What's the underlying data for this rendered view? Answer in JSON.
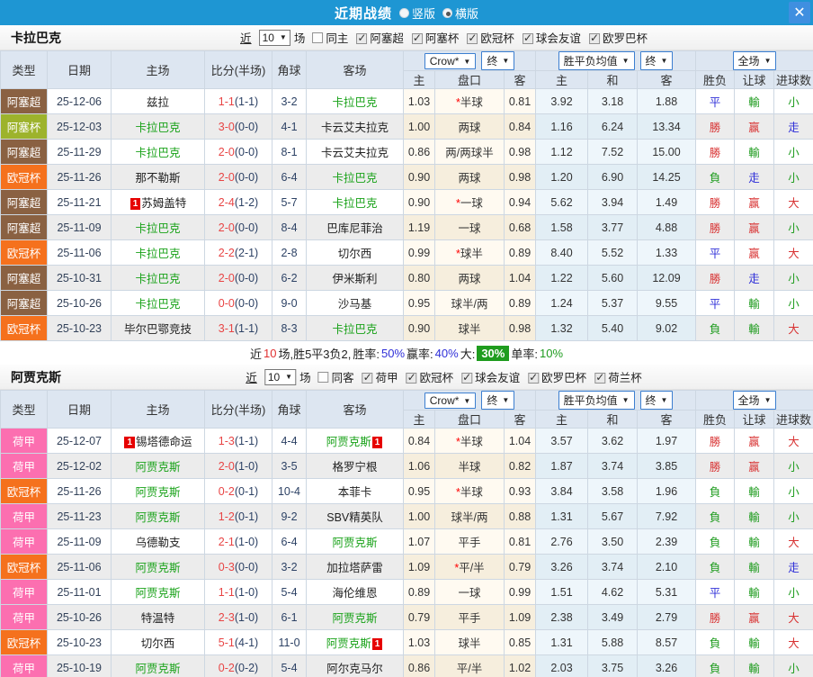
{
  "titlebar": {
    "title": "近期战绩",
    "vertical_label": "竖版",
    "horizontal_label": "横版",
    "selected_layout": "横版"
  },
  "type_colors": {
    "阿塞超": "#8a6142",
    "阿塞杯": "#9db32c",
    "欧冠杯": "#f5711d",
    "荷甲": "#fc6fb0"
  },
  "result_colors": {
    "勝": "r",
    "赢": "r",
    "大": "r",
    "平": "b",
    "走": "b",
    "負": "g",
    "輸": "g",
    "小": "g"
  },
  "tables": [
    {
      "team": "卡拉巴克",
      "filter": {
        "near_label": "近",
        "count": "10",
        "unit_label": "场",
        "same_label": "同主",
        "same_checked": false,
        "leagues": [
          "阿塞超",
          "阿塞杯",
          "欧冠杯",
          "球会友谊",
          "欧罗巴杯"
        ]
      },
      "header": {
        "cols": [
          "类型",
          "日期",
          "主场",
          "比分(半场)",
          "角球",
          "客场"
        ],
        "subcols": [
          "主",
          "盘口",
          "客",
          "主",
          "和",
          "客",
          "胜负",
          "让球",
          "进球数"
        ],
        "odds_source": "Crow*",
        "odds_state": "终",
        "avg_label": "胜平负均值",
        "avg_state": "终",
        "scope": "全场"
      },
      "rows": [
        {
          "type": "阿塞超",
          "date": "25-12-06",
          "home": "兹拉",
          "homeGreen": false,
          "homeBadge": "",
          "score": "1-1",
          "half": "1-1",
          "corner": "3-2",
          "away": "卡拉巴克",
          "awayGreen": true,
          "awayBadge": "",
          "o1": "1.03",
          "star": true,
          "pan": "半球",
          "o2": "0.81",
          "a1": "3.92",
          "a2": "3.18",
          "a3": "1.88",
          "r1": "平",
          "r2": "輸",
          "r3": "小"
        },
        {
          "type": "阿塞杯",
          "date": "25-12-03",
          "home": "卡拉巴克",
          "homeGreen": true,
          "homeBadge": "",
          "score": "3-0",
          "half": "0-0",
          "corner": "4-1",
          "away": "卡云艾夫拉克",
          "awayGreen": false,
          "awayBadge": "",
          "o1": "1.00",
          "star": false,
          "pan": "两球",
          "o2": "0.84",
          "a1": "1.16",
          "a2": "6.24",
          "a3": "13.34",
          "r1": "勝",
          "r2": "赢",
          "r3": "走"
        },
        {
          "type": "阿塞超",
          "date": "25-11-29",
          "home": "卡拉巴克",
          "homeGreen": true,
          "homeBadge": "",
          "score": "2-0",
          "half": "0-0",
          "corner": "8-1",
          "away": "卡云艾夫拉克",
          "awayGreen": false,
          "awayBadge": "",
          "o1": "0.86",
          "star": false,
          "pan": "两/两球半",
          "o2": "0.98",
          "a1": "1.12",
          "a2": "7.52",
          "a3": "15.00",
          "r1": "勝",
          "r2": "輸",
          "r3": "小"
        },
        {
          "type": "欧冠杯",
          "date": "25-11-26",
          "home": "那不勒斯",
          "homeGreen": false,
          "homeBadge": "",
          "score": "2-0",
          "half": "0-0",
          "corner": "6-4",
          "away": "卡拉巴克",
          "awayGreen": true,
          "awayBadge": "",
          "o1": "0.90",
          "star": false,
          "pan": "两球",
          "o2": "0.98",
          "a1": "1.20",
          "a2": "6.90",
          "a3": "14.25",
          "r1": "負",
          "r2": "走",
          "r3": "小"
        },
        {
          "type": "阿塞超",
          "date": "25-11-21",
          "home": "苏姆盖特",
          "homeGreen": false,
          "homeBadge": "1",
          "score": "2-4",
          "half": "1-2",
          "corner": "5-7",
          "away": "卡拉巴克",
          "awayGreen": true,
          "awayBadge": "",
          "o1": "0.90",
          "star": true,
          "pan": "一球",
          "o2": "0.94",
          "a1": "5.62",
          "a2": "3.94",
          "a3": "1.49",
          "r1": "勝",
          "r2": "赢",
          "r3": "大"
        },
        {
          "type": "阿塞超",
          "date": "25-11-09",
          "home": "卡拉巴克",
          "homeGreen": true,
          "homeBadge": "",
          "score": "2-0",
          "half": "0-0",
          "corner": "8-4",
          "away": "巴库尼菲治",
          "awayGreen": false,
          "awayBadge": "",
          "o1": "1.19",
          "star": false,
          "pan": "一球",
          "o2": "0.68",
          "a1": "1.58",
          "a2": "3.77",
          "a3": "4.88",
          "r1": "勝",
          "r2": "赢",
          "r3": "小"
        },
        {
          "type": "欧冠杯",
          "date": "25-11-06",
          "home": "卡拉巴克",
          "homeGreen": true,
          "homeBadge": "",
          "score": "2-2",
          "half": "2-1",
          "corner": "2-8",
          "away": "切尔西",
          "awayGreen": false,
          "awayBadge": "",
          "o1": "0.99",
          "star": true,
          "pan": "球半",
          "o2": "0.89",
          "a1": "8.40",
          "a2": "5.52",
          "a3": "1.33",
          "r1": "平",
          "r2": "赢",
          "r3": "大"
        },
        {
          "type": "阿塞超",
          "date": "25-10-31",
          "home": "卡拉巴克",
          "homeGreen": true,
          "homeBadge": "",
          "score": "2-0",
          "half": "0-0",
          "corner": "6-2",
          "away": "伊米斯利",
          "awayGreen": false,
          "awayBadge": "",
          "o1": "0.80",
          "star": false,
          "pan": "两球",
          "o2": "1.04",
          "a1": "1.22",
          "a2": "5.60",
          "a3": "12.09",
          "r1": "勝",
          "r2": "走",
          "r3": "小"
        },
        {
          "type": "阿塞超",
          "date": "25-10-26",
          "home": "卡拉巴克",
          "homeGreen": true,
          "homeBadge": "",
          "score": "0-0",
          "half": "0-0",
          "corner": "9-0",
          "away": "沙马基",
          "awayGreen": false,
          "awayBadge": "",
          "o1": "0.95",
          "star": false,
          "pan": "球半/两",
          "o2": "0.89",
          "a1": "1.24",
          "a2": "5.37",
          "a3": "9.55",
          "r1": "平",
          "r2": "輸",
          "r3": "小"
        },
        {
          "type": "欧冠杯",
          "date": "25-10-23",
          "home": "毕尔巴鄂竞技",
          "homeGreen": false,
          "homeBadge": "",
          "score": "3-1",
          "half": "1-1",
          "corner": "8-3",
          "away": "卡拉巴克",
          "awayGreen": true,
          "awayBadge": "",
          "o1": "0.90",
          "star": false,
          "pan": "球半",
          "o2": "0.98",
          "a1": "1.32",
          "a2": "5.40",
          "a3": "9.02",
          "r1": "負",
          "r2": "輸",
          "r3": "大"
        }
      ],
      "summary": [
        {
          "t": "近",
          "c": "dark"
        },
        {
          "t": "10",
          "c": "red"
        },
        {
          "t": "场,胜5平3负2, ",
          "c": "dark"
        },
        {
          "t": "胜率:",
          "c": "dark"
        },
        {
          "t": "50%",
          "c": "blue"
        },
        {
          "t": " 赢率:",
          "c": "dark"
        },
        {
          "t": "40%",
          "c": "blue"
        },
        {
          "t": " 大:",
          "c": "dark"
        },
        {
          "t": "30%",
          "c": "greenbox"
        },
        {
          "t": " 单率:",
          "c": "dark"
        },
        {
          "t": "10%",
          "c": "green"
        }
      ]
    },
    {
      "team": "阿贾克斯",
      "filter": {
        "near_label": "近",
        "count": "10",
        "unit_label": "场",
        "same_label": "同客",
        "same_checked": false,
        "leagues": [
          "荷甲",
          "欧冠杯",
          "球会友谊",
          "欧罗巴杯",
          "荷兰杯"
        ]
      },
      "header": {
        "cols": [
          "类型",
          "日期",
          "主场",
          "比分(半场)",
          "角球",
          "客场"
        ],
        "subcols": [
          "主",
          "盘口",
          "客",
          "主",
          "和",
          "客",
          "胜负",
          "让球",
          "进球数"
        ],
        "odds_source": "Crow*",
        "odds_state": "终",
        "avg_label": "胜平负均值",
        "avg_state": "终",
        "scope": "全场"
      },
      "rows": [
        {
          "type": "荷甲",
          "date": "25-12-07",
          "home": "锡塔德命运",
          "homeGreen": false,
          "homeBadge": "1",
          "score": "1-3",
          "half": "1-1",
          "corner": "4-4",
          "away": "阿贾克斯",
          "awayGreen": true,
          "awayBadge": "1",
          "o1": "0.84",
          "star": true,
          "pan": "半球",
          "o2": "1.04",
          "a1": "3.57",
          "a2": "3.62",
          "a3": "1.97",
          "r1": "勝",
          "r2": "赢",
          "r3": "大"
        },
        {
          "type": "荷甲",
          "date": "25-12-02",
          "home": "阿贾克斯",
          "homeGreen": true,
          "homeBadge": "",
          "score": "2-0",
          "half": "1-0",
          "corner": "3-5",
          "away": "格罗宁根",
          "awayGreen": false,
          "awayBadge": "",
          "o1": "1.06",
          "star": false,
          "pan": "半球",
          "o2": "0.82",
          "a1": "1.87",
          "a2": "3.74",
          "a3": "3.85",
          "r1": "勝",
          "r2": "赢",
          "r3": "小"
        },
        {
          "type": "欧冠杯",
          "date": "25-11-26",
          "home": "阿贾克斯",
          "homeGreen": true,
          "homeBadge": "",
          "score": "0-2",
          "half": "0-1",
          "corner": "10-4",
          "away": "本菲卡",
          "awayGreen": false,
          "awayBadge": "",
          "o1": "0.95",
          "star": true,
          "pan": "半球",
          "o2": "0.93",
          "a1": "3.84",
          "a2": "3.58",
          "a3": "1.96",
          "r1": "負",
          "r2": "輸",
          "r3": "小"
        },
        {
          "type": "荷甲",
          "date": "25-11-23",
          "home": "阿贾克斯",
          "homeGreen": true,
          "homeBadge": "",
          "score": "1-2",
          "half": "0-1",
          "corner": "9-2",
          "away": "SBV精英队",
          "awayGreen": false,
          "awayBadge": "",
          "o1": "1.00",
          "star": false,
          "pan": "球半/两",
          "o2": "0.88",
          "a1": "1.31",
          "a2": "5.67",
          "a3": "7.92",
          "r1": "負",
          "r2": "輸",
          "r3": "小"
        },
        {
          "type": "荷甲",
          "date": "25-11-09",
          "home": "乌德勒支",
          "homeGreen": false,
          "homeBadge": "",
          "score": "2-1",
          "half": "1-0",
          "corner": "6-4",
          "away": "阿贾克斯",
          "awayGreen": true,
          "awayBadge": "",
          "o1": "1.07",
          "star": false,
          "pan": "平手",
          "o2": "0.81",
          "a1": "2.76",
          "a2": "3.50",
          "a3": "2.39",
          "r1": "負",
          "r2": "輸",
          "r3": "大"
        },
        {
          "type": "欧冠杯",
          "date": "25-11-06",
          "home": "阿贾克斯",
          "homeGreen": true,
          "homeBadge": "",
          "score": "0-3",
          "half": "0-0",
          "corner": "3-2",
          "away": "加拉塔萨雷",
          "awayGreen": false,
          "awayBadge": "",
          "o1": "1.09",
          "star": true,
          "pan": "平/半",
          "o2": "0.79",
          "a1": "3.26",
          "a2": "3.74",
          "a3": "2.10",
          "r1": "負",
          "r2": "輸",
          "r3": "走"
        },
        {
          "type": "荷甲",
          "date": "25-11-01",
          "home": "阿贾克斯",
          "homeGreen": true,
          "homeBadge": "",
          "score": "1-1",
          "half": "1-0",
          "corner": "5-4",
          "away": "海伦维恩",
          "awayGreen": false,
          "awayBadge": "",
          "o1": "0.89",
          "star": false,
          "pan": "一球",
          "o2": "0.99",
          "a1": "1.51",
          "a2": "4.62",
          "a3": "5.31",
          "r1": "平",
          "r2": "輸",
          "r3": "小"
        },
        {
          "type": "荷甲",
          "date": "25-10-26",
          "home": "特温特",
          "homeGreen": false,
          "homeBadge": "",
          "score": "2-3",
          "half": "1-0",
          "corner": "6-1",
          "away": "阿贾克斯",
          "awayGreen": true,
          "awayBadge": "",
          "o1": "0.79",
          "star": false,
          "pan": "平手",
          "o2": "1.09",
          "a1": "2.38",
          "a2": "3.49",
          "a3": "2.79",
          "r1": "勝",
          "r2": "赢",
          "r3": "大"
        },
        {
          "type": "欧冠杯",
          "date": "25-10-23",
          "home": "切尔西",
          "homeGreen": false,
          "homeBadge": "",
          "score": "5-1",
          "half": "4-1",
          "corner": "11-0",
          "away": "阿贾克斯",
          "awayGreen": true,
          "awayBadge": "1",
          "o1": "1.03",
          "star": false,
          "pan": "球半",
          "o2": "0.85",
          "a1": "1.31",
          "a2": "5.88",
          "a3": "8.57",
          "r1": "負",
          "r2": "輸",
          "r3": "大"
        },
        {
          "type": "荷甲",
          "date": "25-10-19",
          "home": "阿贾克斯",
          "homeGreen": true,
          "homeBadge": "",
          "score": "0-2",
          "half": "0-2",
          "corner": "5-4",
          "away": "阿尔克马尔",
          "awayGreen": false,
          "awayBadge": "",
          "o1": "0.86",
          "star": false,
          "pan": "平/半",
          "o2": "1.02",
          "a1": "2.03",
          "a2": "3.75",
          "a3": "3.26",
          "r1": "負",
          "r2": "輸",
          "r3": "小"
        }
      ],
      "summary": []
    }
  ]
}
